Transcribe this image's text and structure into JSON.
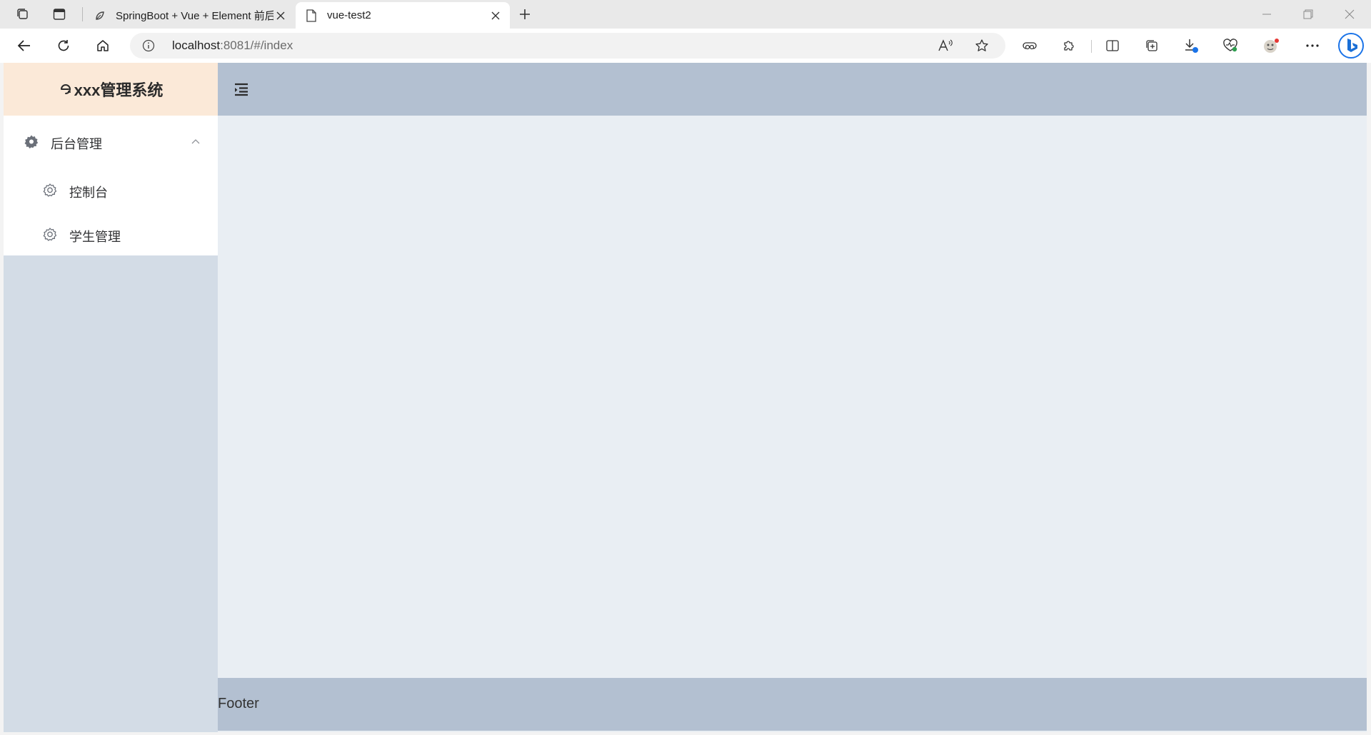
{
  "browser": {
    "tabs": [
      {
        "title": "SpringBoot + Vue + Element 前后",
        "icon": "globe-leaf-icon",
        "active": false
      },
      {
        "title": "vue-test2",
        "icon": "page-icon",
        "active": true
      }
    ],
    "address": {
      "host": "localhost",
      "rest": ":8081/#/index"
    }
  },
  "app": {
    "logo_text": "xxx管理系统",
    "menu": {
      "group_label": "后台管理",
      "items": [
        {
          "label": "控制台"
        },
        {
          "label": "学生管理"
        }
      ]
    },
    "footer_text": "Footer"
  },
  "colors": {
    "logo_bg": "#fbe9d8",
    "aside_bg": "#d3dce6",
    "header_bg": "#b3c0d1",
    "main_bg": "#e9eef3",
    "menu_bg": "#ffffff"
  }
}
